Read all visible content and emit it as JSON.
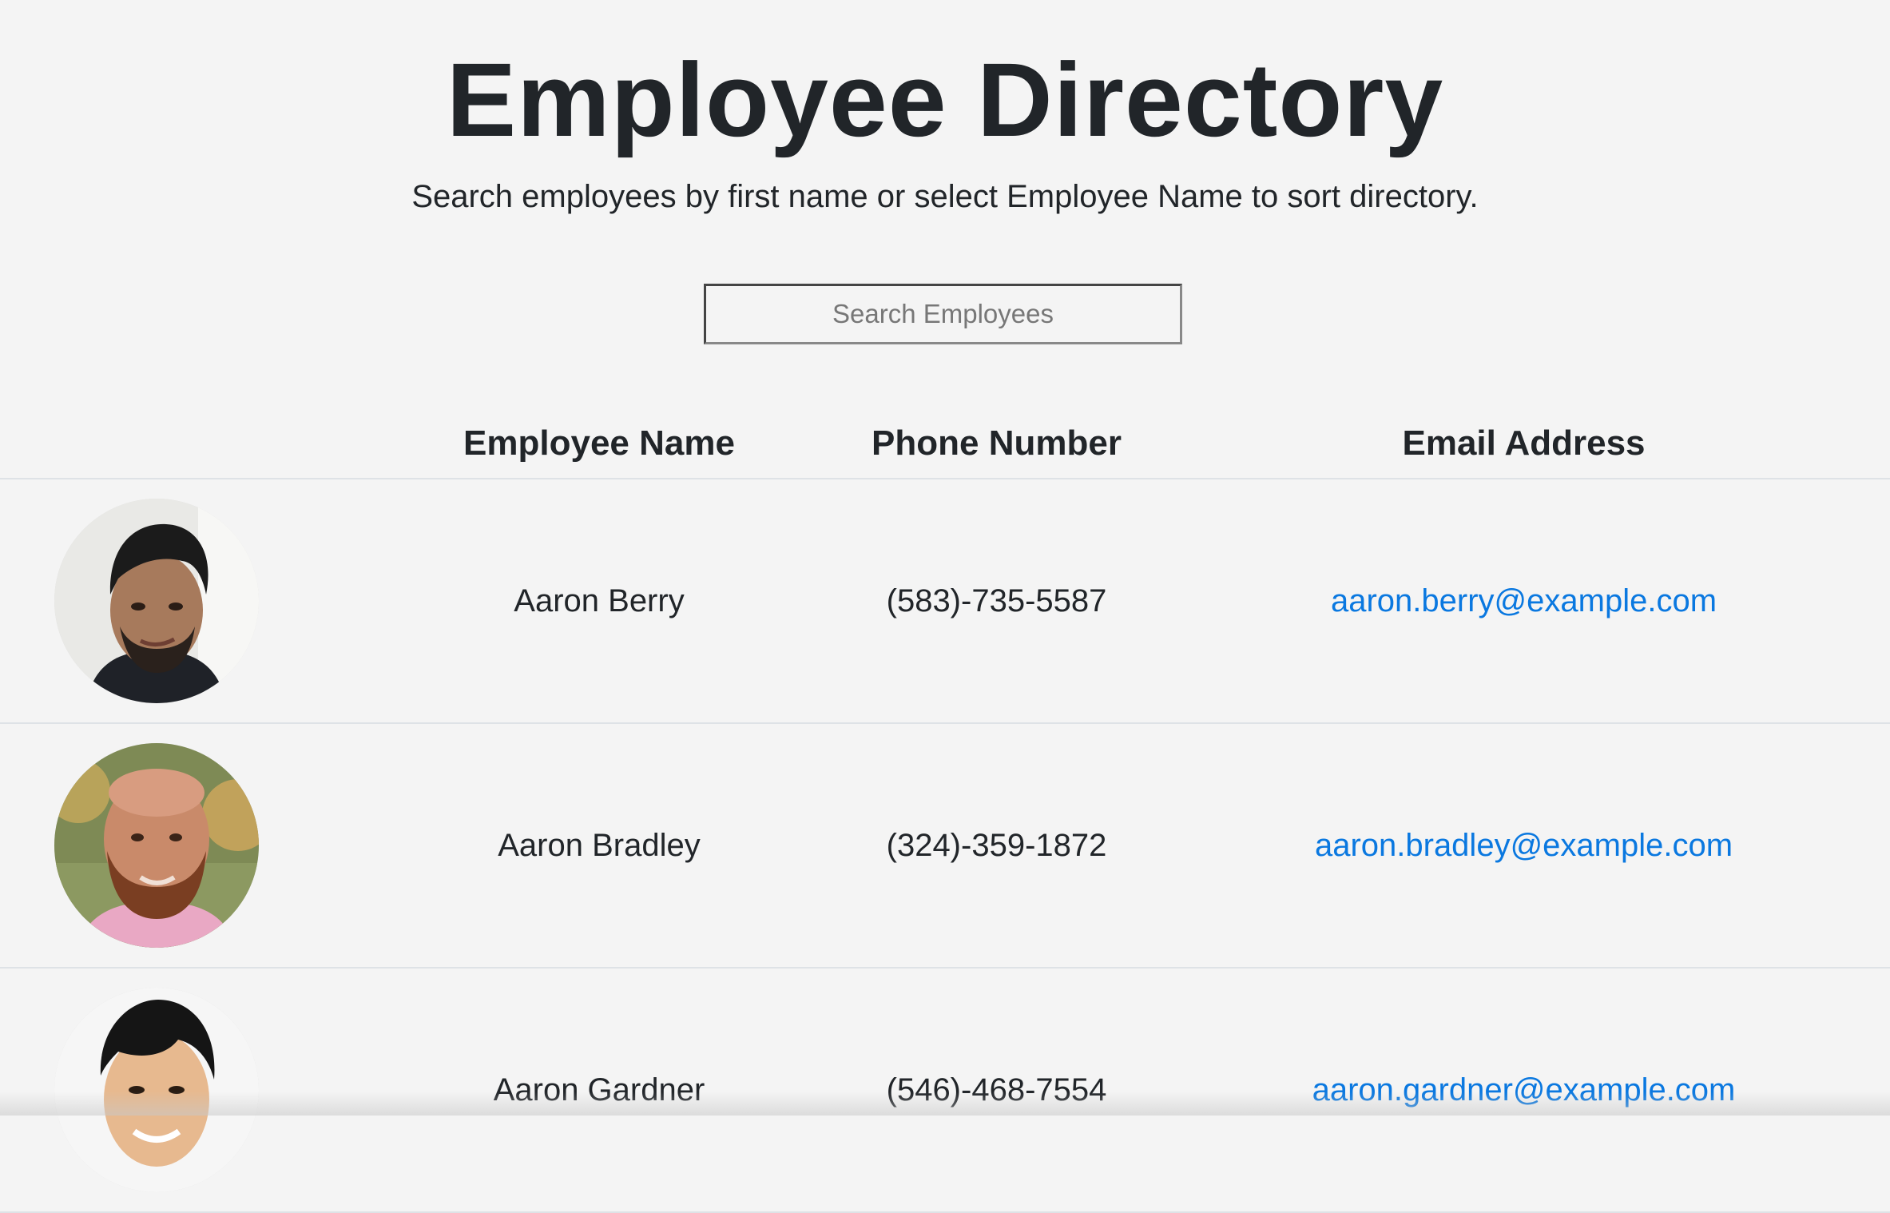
{
  "header": {
    "title": "Employee Directory",
    "subtitle": "Search employees by first name or select Employee Name to sort directory."
  },
  "search": {
    "placeholder": "Search Employees",
    "value": ""
  },
  "table": {
    "columns": {
      "image": "",
      "name": "Employee Name",
      "phone": "Phone Number",
      "email": "Email Address"
    },
    "rows": [
      {
        "name": "Aaron Berry",
        "phone": "(583)-735-5587",
        "email": "aaron.berry@example.com",
        "avatar": "avatar-photo"
      },
      {
        "name": "Aaron Bradley",
        "phone": "(324)-359-1872",
        "email": "aaron.bradley@example.com",
        "avatar": "avatar-photo"
      },
      {
        "name": "Aaron Gardner",
        "phone": "(546)-468-7554",
        "email": "aaron.gardner@example.com",
        "avatar": "avatar-photo"
      }
    ]
  },
  "colors": {
    "background": "#f4f4f4",
    "text": "#212529",
    "link": "#0a78e0",
    "divider": "#dee2e6"
  }
}
